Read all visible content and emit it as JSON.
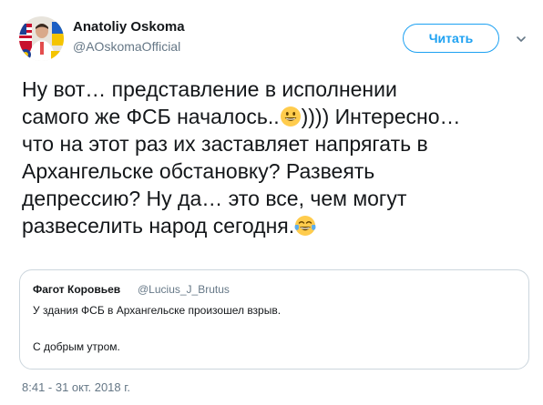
{
  "tweet": {
    "author": {
      "name": "Anatoliy Oskoma",
      "handle": "@AOskomaOfficial",
      "avatar": "avatar-photo"
    },
    "follow_label": "Читать",
    "menu_icon": "chevron-down-icon",
    "text_lines": [
      {
        "parts": [
          "Ну вот… представление в исполнении"
        ]
      },
      {
        "parts": [
          "самого же ФСБ началось..",
          ")))) Интересно…"
        ],
        "emoji": "grinning-face"
      },
      {
        "parts": [
          "что на этот раз их заставляет напрягать в"
        ]
      },
      {
        "parts": [
          "Архангельске обстановку? Развеять"
        ]
      },
      {
        "parts": [
          "депрессию? Ну да… это все, чем могут"
        ]
      },
      {
        "parts": [
          "развеселить народ сегодня."
        ],
        "emoji": "face-with-tears-of-joy"
      }
    ],
    "quoted": {
      "name": "Фагот Коровьев",
      "handle": "@Lucius_J_Brutus",
      "text_line1": "У здания ФСБ в Архангельске произошел взрыв.",
      "text_line2": "С добрым утром."
    },
    "timestamp": "8:41 - 31 окт. 2018 г."
  },
  "colors": {
    "accent": "#1da1f2",
    "text": "#14171a",
    "secondary": "#657786",
    "border": "#ccd6dd"
  }
}
